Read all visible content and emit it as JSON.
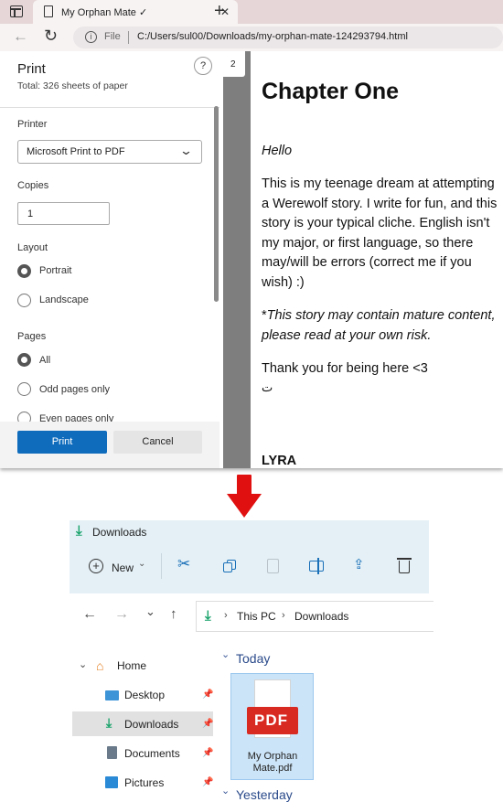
{
  "browser": {
    "tab_title": "My Orphan Mate ✓",
    "new_tab": "+",
    "close": "✕",
    "url_prefix": "File",
    "url": "C:/Users/sul00/Downloads/my-orphan-mate-124293794.html"
  },
  "print": {
    "title": "Print",
    "total": "Total: 326 sheets of paper",
    "help": "?",
    "printer_label": "Printer",
    "printer_value": "Microsoft Print to PDF",
    "copies_label": "Copies",
    "copies_value": "1",
    "layout_label": "Layout",
    "layout_options": [
      "Portrait",
      "Landscape"
    ],
    "pages_label": "Pages",
    "pages_options": [
      "All",
      "Odd pages only",
      "Even pages only"
    ],
    "print_button": "Print",
    "cancel_button": "Cancel",
    "page_number": "2"
  },
  "preview": {
    "heading": "Chapter One",
    "hello": "Hello",
    "para1": "This is my teenage dream at attempting a Werewolf story. I write for fun, and this story is your typical cliche. English isn't my major, or first language, so there may/will be errors (correct me if you wish) :)",
    "para2_star": "*",
    "para2": "This story may contain mature content, please read at your own risk.",
    "para3": "Thank you for being here <3",
    "para3_b": "ت",
    "name": "LYRA"
  },
  "explorer": {
    "title": "Downloads",
    "new_label": "New",
    "breadcrumb": [
      "This PC",
      "Downloads"
    ],
    "tree": [
      {
        "label": "Home"
      },
      {
        "label": "Desktop"
      },
      {
        "label": "Downloads"
      },
      {
        "label": "Documents"
      },
      {
        "label": "Pictures"
      }
    ],
    "group_today": "Today",
    "group_yesterday": "Yesterday",
    "file_badge": "PDF",
    "file_name": "My Orphan Mate.pdf"
  },
  "colors": {
    "accent": "#0f6cbd",
    "arrow": "#e01010",
    "downloads_green": "#1aa36b",
    "pdf_red": "#d92a22"
  }
}
